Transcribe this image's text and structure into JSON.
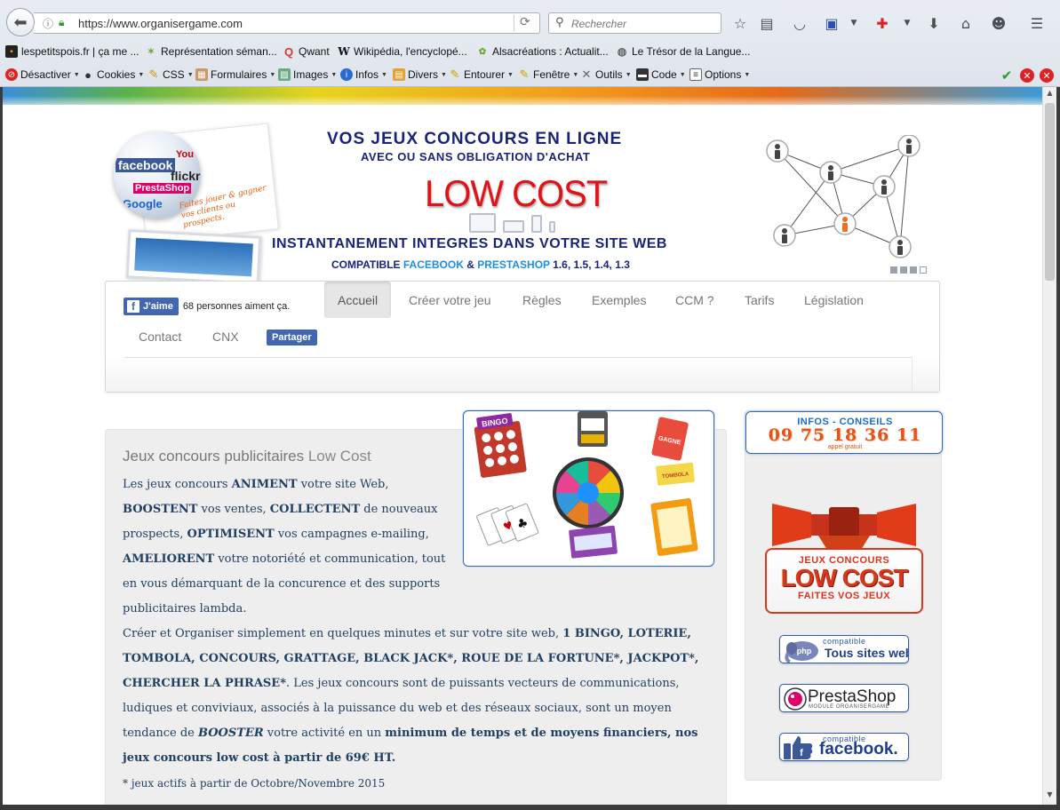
{
  "browser": {
    "url": "https://www.organisergame.com",
    "search_placeholder": "Rechercher",
    "bookmarks": [
      {
        "label": "lespetitspois.fr | ça me ..."
      },
      {
        "label": "Représentation séman..."
      },
      {
        "label": "Qwant"
      },
      {
        "label": "Wikipédia, l'encyclopé..."
      },
      {
        "label": "Alsacréations : Actualit..."
      },
      {
        "label": "Le Trésor de la Langue..."
      }
    ],
    "devbar": [
      {
        "label": "Désactiver"
      },
      {
        "label": "Cookies"
      },
      {
        "label": "CSS"
      },
      {
        "label": "Formulaires"
      },
      {
        "label": "Images"
      },
      {
        "label": "Infos"
      },
      {
        "label": "Divers"
      },
      {
        "label": "Entourer"
      },
      {
        "label": "Fenêtre"
      },
      {
        "label": "Outils"
      },
      {
        "label": "Code"
      },
      {
        "label": "Options"
      }
    ]
  },
  "banner": {
    "line1": "VOS JEUX CONCOURS EN LIGNE",
    "line2": "AVEC OU SANS OBLIGATION D'ACHAT",
    "headline": "LOW COST",
    "line3": "INSTANTANEMENT INTEGRES DANS VOTRE SITE WEB",
    "line4_prefix": "COMPATIBLE ",
    "line4_fb": "FACEBOOK",
    "line4_amp": " & ",
    "line4_ps": "PRESTASHOP",
    "line4_suffix": " 1.6, 1.5, 1.4, 1.3",
    "tagline": "Faites jouer & gagner vos clients ou prospects.",
    "globe_labels": [
      "facebook",
      "flickr",
      "PrestaShop",
      "Google",
      "You"
    ]
  },
  "nav": {
    "like_label": "J'aime",
    "like_count": "68 personnes aiment ça.",
    "share_label": "Partager",
    "items": [
      "Accueil",
      "Créer votre jeu",
      "Règles",
      "Exemples",
      "CCM ?",
      "Tarifs",
      "Législation",
      "Contact",
      "CNX"
    ]
  },
  "main": {
    "title_a": "Jeux concours publicitaires ",
    "title_b": "Low Cost",
    "p1": [
      {
        "t": "Les jeux concours ",
        "b": false
      },
      {
        "t": "ANIMENT",
        "b": true
      },
      {
        "t": " votre site Web, ",
        "b": false
      },
      {
        "t": "BOOSTENT",
        "b": true
      },
      {
        "t": " vos ventes, ",
        "b": false
      },
      {
        "t": "COLLECTENT",
        "b": true
      },
      {
        "t": " de nouveaux prospects, ",
        "b": false
      },
      {
        "t": "OPTIMISENT",
        "b": true
      },
      {
        "t": " vos campagnes e-mailing, ",
        "b": false
      },
      {
        "t": "AMELIORENT",
        "b": true
      },
      {
        "t": " votre notoriété et communication, tout en vous démarquant de la concurence et des supports publicitaires lambda.",
        "b": false
      }
    ],
    "p2": [
      {
        "t": "Créer et Organiser simplement en quelques minutes et sur votre site web, ",
        "b": false
      },
      {
        "t": "1 BINGO, LOTERIE, TOMBOLA, CONCOURS, GRATTAGE, BLACK JACK*, ROUE DE LA FORTUNE*, JACKPOT*, CHERCHER LA PHRASE*",
        "b": true
      },
      {
        "t": ". Les jeux concours sont de puissants vecteurs de communications, ludiques et conviviaux, associés à la puissance du web et des réseaux sociaux, sont un moyen tendance de ",
        "b": false
      },
      {
        "t": "BOOSTER",
        "b": true,
        "i": true
      },
      {
        "t": " votre activité en un ",
        "b": false
      },
      {
        "t": "minimum de temps et de moyens financiers, nos jeux concours low cost à partir de 69€ HT.",
        "b": true
      }
    ],
    "footnote": "* jeux actifs à partir de Octobre/Novembre 2015",
    "games": [
      "BINGO",
      "GAGNE",
      "TOMBOLA"
    ]
  },
  "sidebar": {
    "phone_label": "INFOS - CONSEILS",
    "phone_number": "09 75 18 36 11",
    "phone_sub": "appel gratuit",
    "badge_line1": "JEUX CONCOURS",
    "badge_line2": "LOW COST",
    "badge_line3": "FAITES VOS JEUX",
    "compat_php_small": "compatible",
    "compat_php_big": "Tous sites web",
    "compat_ps_big": "PrestaShop",
    "compat_ps_small": "MODULE ORGANISERGAME",
    "compat_fb_small": "compatible",
    "compat_fb_big": "facebook."
  },
  "colors": {
    "nav_blue": "#1a2477",
    "lowcost_red": "#e21216",
    "text_blue": "#1f3f63",
    "orange": "#e5521a",
    "fb_blue": "#4267b2"
  }
}
